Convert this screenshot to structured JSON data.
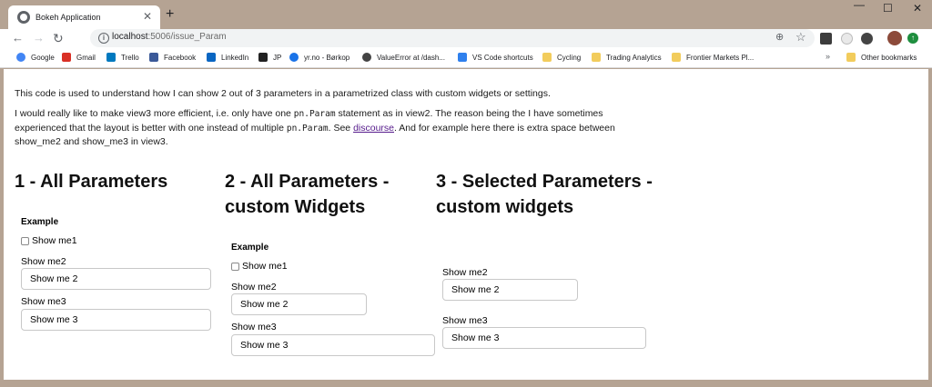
{
  "browser": {
    "tab_title": "Bokeh Application",
    "url_host": "localhost",
    "url_path": ":5006/issue_Param",
    "new_tab_label": "+",
    "bookmarks": [
      {
        "label": "Google",
        "color": "#4285f4"
      },
      {
        "label": "Gmail",
        "color": "#d93025"
      },
      {
        "label": "Trello",
        "color": "#0079bf"
      },
      {
        "label": "Facebook",
        "color": "#3b5998"
      },
      {
        "label": "LinkedIn",
        "color": "#0a66c2"
      },
      {
        "label": "JP",
        "color": "#222222"
      },
      {
        "label": "yr.no - Børkop",
        "color": "#1a73e8"
      },
      {
        "label": "ValueError at /dash...",
        "color": "#444444"
      },
      {
        "label": "VS Code shortcuts",
        "color": "#2f80ed"
      },
      {
        "label": "Cycling",
        "color": "#f2cc5c"
      },
      {
        "label": "Trading Analytics",
        "color": "#f2cc5c"
      },
      {
        "label": "Frontier Markets Pl...",
        "color": "#f2cc5c"
      }
    ],
    "other_bookmarks": "Other bookmarks",
    "more_glyph": "»"
  },
  "page": {
    "intro1": "This code is used to understand how I can show 2 out of 3 parameters in a parametrized class with custom widgets or settings.",
    "intro2_a": "I would really like to make view3 more efficient, i.e. only have one ",
    "intro2_code1": "pn.Param",
    "intro2_b": " statement as in view2. The reason being the I have sometimes experienced that the layout is better with one instead of multiple ",
    "intro2_code2": "pn.Param",
    "intro2_c": ". See ",
    "intro2_link": "discourse",
    "intro2_d": ". And for example here there is extra space between show_me2 and show_me3 in view3.",
    "col1": {
      "title": "1 - All Parameters",
      "widget_title": "Example",
      "check_label": "Show me1",
      "me2_label": "Show me2",
      "me2_value": "Show me 2",
      "me3_label": "Show me3",
      "me3_value": "Show me 3"
    },
    "col2": {
      "title": "2 - All Parameters - custom Widgets",
      "widget_title": "Example",
      "check_label": "Show me1",
      "me2_label": "Show me2",
      "me2_value": "Show me 2",
      "me3_label": "Show me3",
      "me3_value": "Show me 3"
    },
    "col3": {
      "title": "3 - Selected Parameters - custom widgets",
      "me2_label": "Show me2",
      "me2_value": "Show me 2",
      "me3_label": "Show me3",
      "me3_value": "Show me 3"
    }
  }
}
